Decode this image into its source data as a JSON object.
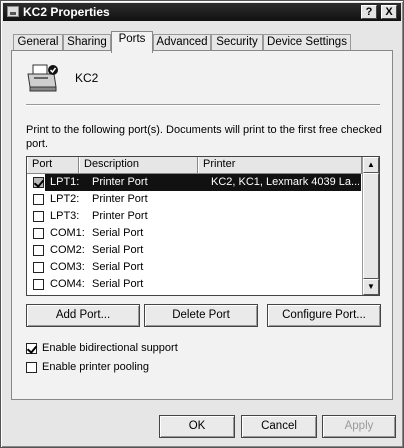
{
  "window": {
    "title": "KC2 Properties",
    "help_button": "?",
    "close_button": "X"
  },
  "tabs": [
    {
      "label": "General"
    },
    {
      "label": "Sharing"
    },
    {
      "label": "Ports",
      "active": true
    },
    {
      "label": "Advanced"
    },
    {
      "label": "Security"
    },
    {
      "label": "Device Settings"
    }
  ],
  "printer": {
    "name": "KC2",
    "icon": "printer-icon"
  },
  "instructions": "Print to the following port(s). Documents will print to the first free checked port.",
  "ports": {
    "columns": [
      "Port",
      "Description",
      "Printer"
    ],
    "rows": [
      {
        "port": "LPT1:",
        "description": "Printer Port",
        "printer": "KC2, KC1, Lexmark 4039 La...",
        "checked": true,
        "selected": true
      },
      {
        "port": "LPT2:",
        "description": "Printer Port",
        "printer": "",
        "checked": false,
        "selected": false
      },
      {
        "port": "LPT3:",
        "description": "Printer Port",
        "printer": "",
        "checked": false,
        "selected": false
      },
      {
        "port": "COM1:",
        "description": "Serial Port",
        "printer": "",
        "checked": false,
        "selected": false
      },
      {
        "port": "COM2:",
        "description": "Serial Port",
        "printer": "",
        "checked": false,
        "selected": false
      },
      {
        "port": "COM3:",
        "description": "Serial Port",
        "printer": "",
        "checked": false,
        "selected": false
      },
      {
        "port": "COM4:",
        "description": "Serial Port",
        "printer": "",
        "checked": false,
        "selected": false
      }
    ]
  },
  "port_buttons": {
    "add": "Add Port...",
    "delete": "Delete Port",
    "configure": "Configure Port..."
  },
  "options": {
    "bidirectional": {
      "label": "Enable bidirectional support",
      "checked": true
    },
    "pooling": {
      "label": "Enable printer pooling",
      "checked": false
    }
  },
  "dialog_buttons": {
    "ok": "OK",
    "cancel": "Cancel",
    "apply": "Apply"
  }
}
